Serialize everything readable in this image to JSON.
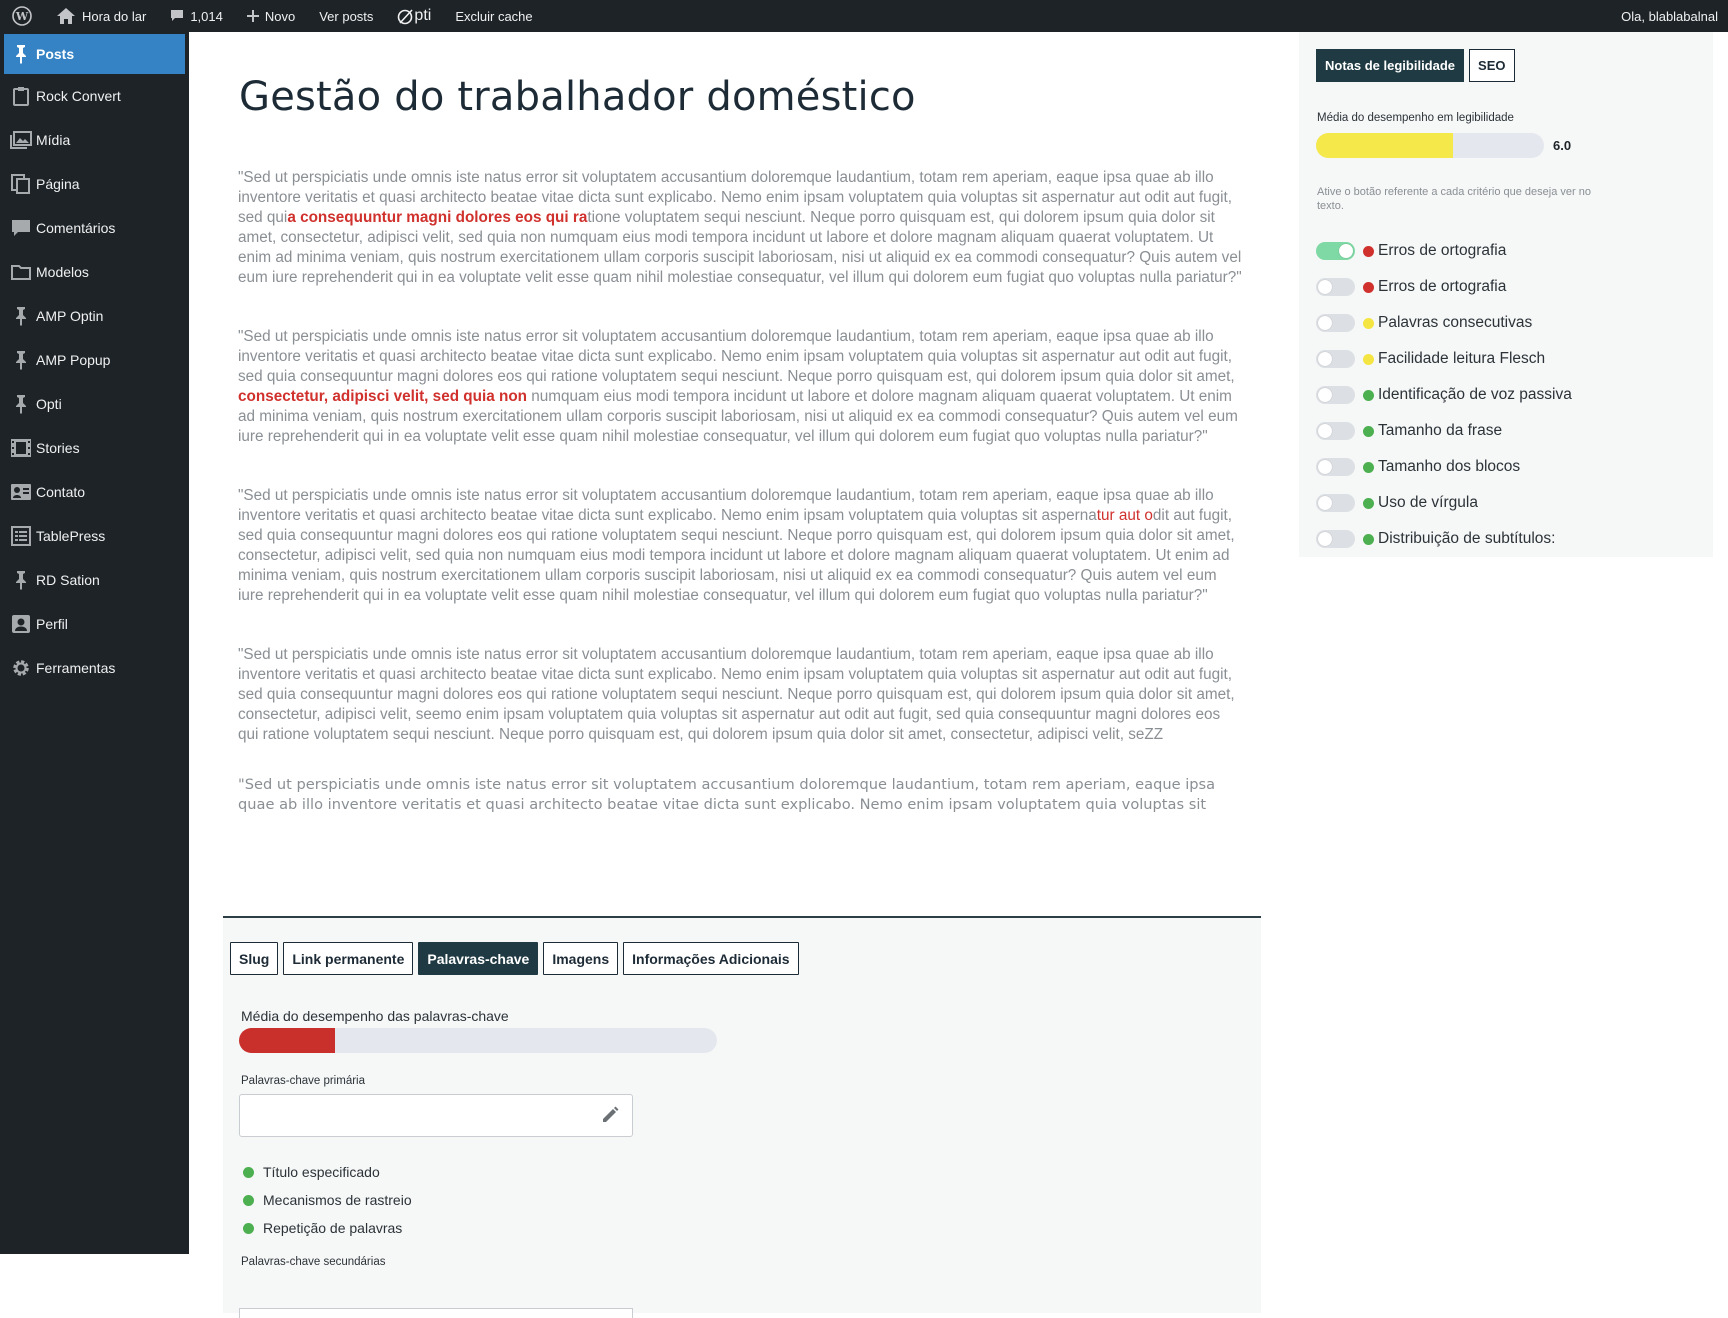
{
  "topbar": {
    "site_name": "Hora do lar",
    "comments_count": "1,014",
    "new_label": "Novo",
    "view_posts_label": "Ver posts",
    "opti_label": "pti",
    "clear_cache_label": "Excluir cache",
    "greeting": "Ola, blablabalnal"
  },
  "sidebar": {
    "items": [
      {
        "label": "Posts",
        "icon": "pin-icon"
      },
      {
        "label": "Rock Convert",
        "icon": "clipboard-icon"
      },
      {
        "label": "Mídia",
        "icon": "media-icon"
      },
      {
        "label": "Página",
        "icon": "page-icon"
      },
      {
        "label": "Comentários",
        "icon": "comment-icon"
      },
      {
        "label": "Modelos",
        "icon": "folder-icon"
      },
      {
        "label": "AMP Optin",
        "icon": "pin-icon"
      },
      {
        "label": "AMP Popup",
        "icon": "pin-icon"
      },
      {
        "label": "Opti",
        "icon": "pin-icon"
      },
      {
        "label": "Stories",
        "icon": "film-icon"
      },
      {
        "label": "Contato",
        "icon": "contact-icon"
      },
      {
        "label": "TablePress",
        "icon": "table-icon"
      },
      {
        "label": "RD Sation",
        "icon": "pin-icon"
      },
      {
        "label": "Perfil",
        "icon": "user-icon"
      },
      {
        "label": "Ferramentas",
        "icon": "gear-icon"
      }
    ]
  },
  "post": {
    "title": "Gestão do trabalhador doméstico",
    "p1": {
      "a": "\"Sed ut perspiciatis unde omnis iste natus error sit voluptatem accusantium doloremque laudantium, totam rem aperiam, eaque ipsa quae ab illo inventore veritatis et quasi architecto beatae vitae dicta sunt explicabo. Nemo enim ipsam voluptatem quia voluptas sit aspernatur aut odit aut fugit, sed qui",
      "hl": "a consequuntur magni dolores eos qui ra",
      "b": "tione voluptatem sequi nesciunt. Neque porro quisquam est, qui dolorem ipsum quia dolor sit amet, consectetur, adipisci velit, sed quia non numquam eius modi tempora incidunt ut labore et dolore magnam aliquam quaerat voluptatem. Ut enim ad minima veniam, quis nostrum exercitationem ullam corporis suscipit laboriosam, nisi ut aliquid ex ea commodi consequatur? Quis autem vel eum iure reprehenderit qui in ea voluptate velit esse quam nihil molestiae consequatur, vel illum qui dolorem eum fugiat quo voluptas nulla pariatur?\""
    },
    "p2": {
      "a": "\"Sed ut perspiciatis unde omnis iste natus error sit voluptatem accusantium doloremque laudantium, totam rem aperiam, eaque ipsa quae ab illo inventore veritatis et quasi architecto beatae vitae dicta sunt explicabo. Nemo enim ipsam voluptatem quia voluptas sit aspernatur aut odit aut fugit, sed quia consequuntur magni dolores eos qui ratione voluptatem sequi nesciunt. Neque porro quisquam est, qui dolorem ipsum quia dolor sit amet, ",
      "hl": "consectetur, adipisci velit, sed quia non",
      "b": " numquam eius modi tempora incidunt ut labore et dolore magnam aliquam quaerat voluptatem. Ut enim ad minima veniam, quis nostrum exercitationem ullam corporis suscipit laboriosam, nisi ut aliquid ex ea commodi consequatur? Quis autem vel eum iure reprehenderit qui in ea voluptate velit esse quam nihil molestiae consequatur, vel illum qui dolorem eum fugiat quo voluptas nulla pariatur?\""
    },
    "p3": {
      "a": "\"Sed ut perspiciatis unde omnis iste natus error sit voluptatem accusantium doloremque laudantium, totam rem aperiam, eaque ipsa quae ab illo inventore veritatis et quasi architecto beatae vitae dicta sunt explicabo. Nemo enim ipsam voluptatem quia voluptas sit asperna",
      "hl": "tur aut o",
      "b": "dit aut fugit, sed quia consequuntur magni dolores eos qui ratione voluptatem sequi nesciunt. Neque porro quisquam est, qui dolorem ipsum quia dolor sit amet, consectetur, adipisci velit, sed quia non numquam eius modi tempora incidunt ut labore et dolore magnam aliquam quaerat voluptatem. Ut enim ad minima veniam, quis nostrum exercitationem ullam corporis suscipit laboriosam, nisi ut aliquid ex ea commodi consequatur? Quis autem vel eum iure reprehenderit qui in ea voluptate velit esse quam nihil molestiae consequatur, vel illum qui dolorem eum fugiat quo voluptas nulla pariatur?\""
    },
    "p4": "\"Sed ut perspiciatis unde omnis iste natus error sit voluptatem accusantium doloremque laudantium, totam rem aperiam, eaque ipsa quae ab illo inventore veritatis et quasi architecto beatae vitae dicta sunt explicabo. Nemo enim ipsam voluptatem quia voluptas sit aspernatur aut odit aut fugit, sed quia consequuntur magni dolores eos qui ratione voluptatem sequi nesciunt. Neque porro quisquam est, qui dolorem ipsum quia dolor sit amet, consectetur, adipisci velit, seemo enim ipsam voluptatem quia voluptas sit aspernatur aut odit aut fugit, sed quia consequuntur magni dolores eos qui ratione voluptatem sequi nesciunt. Neque porro quisquam est, qui dolorem ipsum quia dolor sit amet, consectetur, adipisci velit, seZZ",
    "p5": "\"Sed ut perspiciatis unde omnis iste natus error sit voluptatem accusantium doloremque laudantium, totam rem aperiam, eaque ipsa quae ab illo inventore veritatis et quasi architecto beatae vitae dicta sunt explicabo. Nemo enim ipsam voluptatem quia voluptas sit"
  },
  "bottom": {
    "tabs": [
      "Slug",
      "Link permanente",
      "Palavras-chave",
      "Imagens",
      "Informações Adicionais"
    ],
    "active_tab": "Palavras-chave",
    "kw_avg_label": "Média do desempenho das palavras-chave",
    "kw_score_fraction": 0.2,
    "primary_label": "Palavras-chave primária",
    "primary_value": "",
    "checks": [
      "Título especificado",
      "Mecanismos de rastreio",
      "Repetição de palavras"
    ],
    "secondary_label": "Palavras-chave secundárias"
  },
  "readability": {
    "tabs": [
      "Notas de legibilidade",
      "SEO"
    ],
    "avg_label": "Média do desempenho em legibilidade",
    "score": "6.0",
    "score_fraction": 0.6,
    "hint": "Ative o botão referente a cada critério que deseja ver no texto.",
    "criteria": [
      {
        "label": "Erros de ortografia",
        "status": "red",
        "on": true
      },
      {
        "label": "Erros de ortografia",
        "status": "red",
        "on": false
      },
      {
        "label": "Palavras consecutivas",
        "status": "yellow",
        "on": false
      },
      {
        "label": "Facilidade leitura Flesch",
        "status": "yellow",
        "on": false
      },
      {
        "label": "Identificação de voz passiva",
        "status": "green",
        "on": false
      },
      {
        "label": "Tamanho da frase",
        "status": "green",
        "on": false
      },
      {
        "label": "Tamanho dos blocos",
        "status": "green",
        "on": false
      },
      {
        "label": "Uso de vírgula",
        "status": "green",
        "on": false
      },
      {
        "label": "Distribuição de subtítulos:",
        "status": "green",
        "on": false
      }
    ]
  },
  "colors": {
    "admin_bar": "#1d2327",
    "active_menu": "#3582c4",
    "highlight": "#d0312d",
    "status_green": "#4caf50",
    "status_yellow": "#f4e542",
    "status_red": "#d0312d"
  }
}
